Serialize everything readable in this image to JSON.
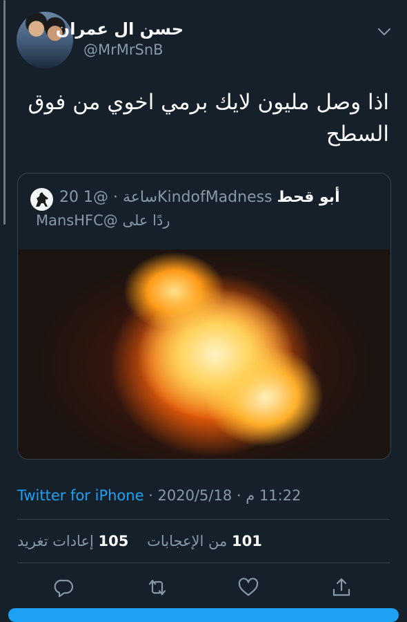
{
  "tweet": {
    "author_name": "حسن ال عمران",
    "author_handle": "@MrMrSnB",
    "text": "اذا وصل مليون لايك برمي اخوي من فوق السطح"
  },
  "quoted_tweet": {
    "author_name": "أبو قحط",
    "author_handle": "@1KindofMadness",
    "time_ago": "20 ساعة",
    "reply_prefix": "ردًا على",
    "reply_to": "@MansHFC"
  },
  "meta": {
    "time": "11:22 م",
    "date": "2020/5/18",
    "source": "Twitter for iPhone"
  },
  "stats": {
    "likes_count": "101",
    "likes_label": "من الإعجابات",
    "retweets_count": "105",
    "retweets_label": "إعادات تغريد"
  },
  "icons": {
    "menu": "chevron-down-icon",
    "reply": "reply-icon",
    "retweet": "retweet-icon",
    "like": "heart-icon",
    "share": "share-icon"
  },
  "colors": {
    "background": "#15202b",
    "accent": "#1da1f2",
    "secondary_text": "#8899a6",
    "border": "#38444d"
  }
}
